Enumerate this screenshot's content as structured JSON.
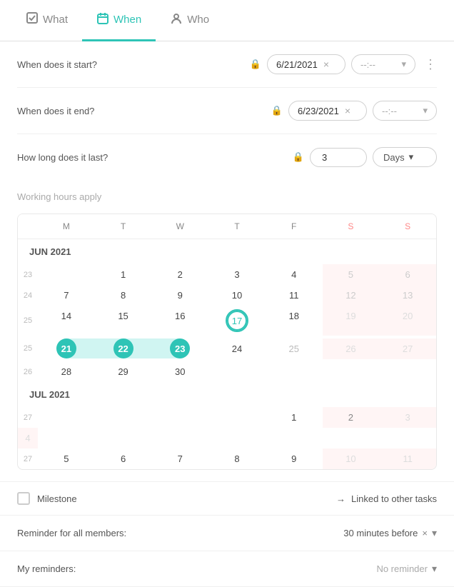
{
  "tabs": [
    {
      "id": "what",
      "label": "What",
      "icon": "checkbox",
      "active": false
    },
    {
      "id": "when",
      "label": "When",
      "icon": "calendar",
      "active": true
    },
    {
      "id": "who",
      "label": "Who",
      "icon": "person",
      "active": false
    }
  ],
  "form": {
    "start_label": "When does it start?",
    "start_date": "6/21/2021",
    "start_time_placeholder": "--:--",
    "end_label": "When does it end?",
    "end_date": "6/23/2021",
    "end_time_placeholder": "--:--",
    "duration_label": "How long does it last?",
    "duration_value": "3",
    "duration_unit": "Days"
  },
  "working_hours": {
    "label": "Working hours apply"
  },
  "calendar": {
    "month1": "JUN 2021",
    "month2": "JUL 2021",
    "day_headers": [
      "M",
      "T",
      "W",
      "T",
      "F",
      "S",
      "S"
    ],
    "june_rows": [
      {
        "week": "23",
        "days": [
          {
            "num": "",
            "type": "empty"
          },
          {
            "num": "1",
            "type": ""
          },
          {
            "num": "2",
            "type": ""
          },
          {
            "num": "3",
            "type": ""
          },
          {
            "num": "4",
            "type": ""
          },
          {
            "num": "5",
            "type": "weekend"
          },
          {
            "num": "6",
            "type": "weekend"
          }
        ]
      },
      {
        "week": "24",
        "days": [
          {
            "num": "7",
            "type": ""
          },
          {
            "num": "8",
            "type": ""
          },
          {
            "num": "9",
            "type": ""
          },
          {
            "num": "10",
            "type": ""
          },
          {
            "num": "11",
            "type": ""
          },
          {
            "num": "12",
            "type": "weekend"
          },
          {
            "num": "13",
            "type": "weekend"
          }
        ]
      },
      {
        "week": "25",
        "days": [
          {
            "num": "14",
            "type": ""
          },
          {
            "num": "15",
            "type": ""
          },
          {
            "num": "16",
            "type": ""
          },
          {
            "num": "17",
            "type": "today"
          },
          {
            "num": "18",
            "type": ""
          },
          {
            "num": "19",
            "type": "weekend"
          },
          {
            "num": "20",
            "type": "weekend"
          }
        ]
      },
      {
        "week": "25",
        "days": [
          {
            "num": "21",
            "type": "sel-start"
          },
          {
            "num": "22",
            "type": "sel-mid"
          },
          {
            "num": "23",
            "type": "sel-end"
          },
          {
            "num": "24",
            "type": ""
          },
          {
            "num": "25",
            "type": "greyed"
          },
          {
            "num": "26",
            "type": "weekend-greyed"
          },
          {
            "num": "27",
            "type": "weekend-greyed"
          }
        ]
      },
      {
        "week": "26",
        "days": [
          {
            "num": "28",
            "type": ""
          },
          {
            "num": "29",
            "type": ""
          },
          {
            "num": "30",
            "type": ""
          },
          {
            "num": "",
            "type": "empty"
          },
          {
            "num": "",
            "type": "empty"
          },
          {
            "num": "",
            "type": "empty"
          },
          {
            "num": "",
            "type": "empty"
          }
        ]
      }
    ],
    "july_rows": [
      {
        "week": "27",
        "days": [
          {
            "num": "",
            "type": "empty"
          },
          {
            "num": "",
            "type": "empty"
          },
          {
            "num": "",
            "type": "empty"
          },
          {
            "num": "",
            "type": "empty"
          },
          {
            "num": "1",
            "type": ""
          },
          {
            "num": "2",
            "type": "weekend"
          },
          {
            "num": "3",
            "type": "weekend-greyed"
          },
          {
            "num": "4",
            "type": "weekend-greyed"
          }
        ]
      },
      {
        "week": "27",
        "days": [
          {
            "num": "5",
            "type": ""
          },
          {
            "num": "6",
            "type": ""
          },
          {
            "num": "7",
            "type": ""
          },
          {
            "num": "8",
            "type": ""
          },
          {
            "num": "9",
            "type": ""
          },
          {
            "num": "10",
            "type": "weekend-greyed"
          },
          {
            "num": "11",
            "type": "weekend-greyed"
          }
        ]
      }
    ]
  },
  "milestone": {
    "label": "Milestone",
    "linked_arrow": "→",
    "linked_label": "Linked to other tasks"
  },
  "reminders": {
    "all_members_label": "Reminder for all members:",
    "all_members_value": "30 minutes before",
    "all_members_x": "×",
    "my_reminders_label": "My reminders:",
    "my_reminders_placeholder": "No reminder"
  }
}
